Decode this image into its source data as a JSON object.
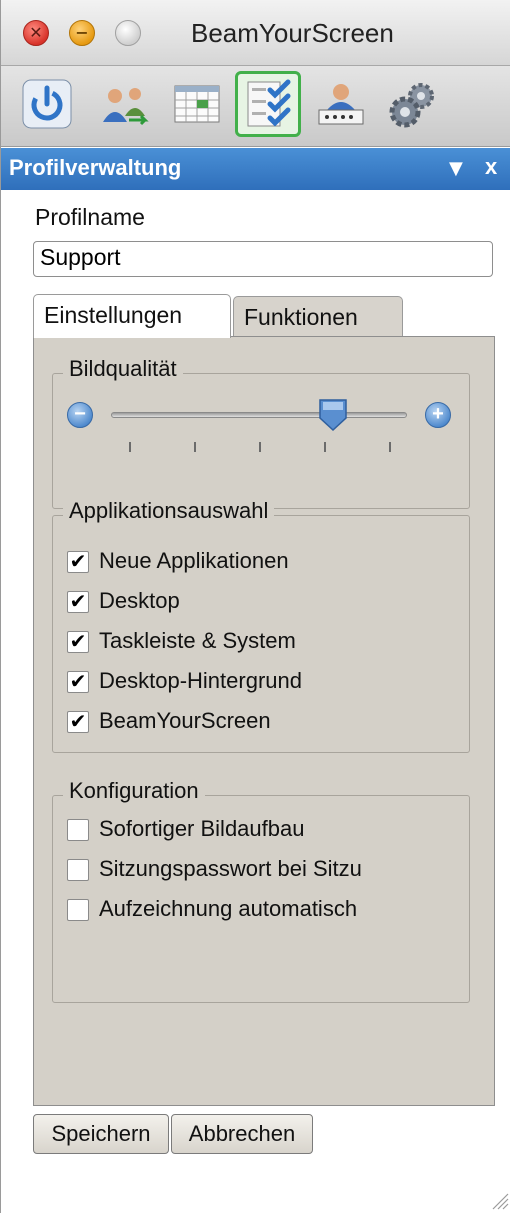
{
  "window": {
    "title": "BeamYourScreen",
    "controls": [
      "close",
      "minimize",
      "zoom"
    ]
  },
  "toolbar": {
    "buttons": [
      {
        "icon": "power-icon",
        "active": false
      },
      {
        "icon": "users-transfer-icon",
        "active": false
      },
      {
        "icon": "calendar-icon",
        "active": false
      },
      {
        "icon": "checklist-icon",
        "active": true
      },
      {
        "icon": "user-password-icon",
        "active": false
      },
      {
        "icon": "gears-icon",
        "active": false
      }
    ]
  },
  "panel": {
    "title": "Profilverwaltung",
    "dropdown_glyph": "▼",
    "close_glyph": "x"
  },
  "profile": {
    "label": "Profilname",
    "value": "Support"
  },
  "tabs": [
    {
      "label": "Einstellungen",
      "active": true
    },
    {
      "label": "Funktionen",
      "active": false
    }
  ],
  "bildqualitaet": {
    "title": "Bildqualität",
    "level": 0.75,
    "ticks": 5
  },
  "applikationsauswahl": {
    "title": "Applikationsauswahl",
    "items": [
      {
        "label": "Neue Applikationen",
        "checked": true
      },
      {
        "label": "Desktop",
        "checked": true
      },
      {
        "label": "Taskleiste & System",
        "checked": true
      },
      {
        "label": "Desktop-Hintergrund",
        "checked": true
      },
      {
        "label": "BeamYourScreen",
        "checked": true
      }
    ]
  },
  "konfiguration": {
    "title": "Konfiguration",
    "items": [
      {
        "label": "Sofortiger Bildaufbau",
        "checked": false
      },
      {
        "label": "Sitzungspasswort bei Sitzu",
        "checked": false
      },
      {
        "label": "Aufzeichnung automatisch",
        "checked": false
      }
    ]
  },
  "buttons": {
    "save": "Speichern",
    "cancel": "Abbrechen"
  }
}
